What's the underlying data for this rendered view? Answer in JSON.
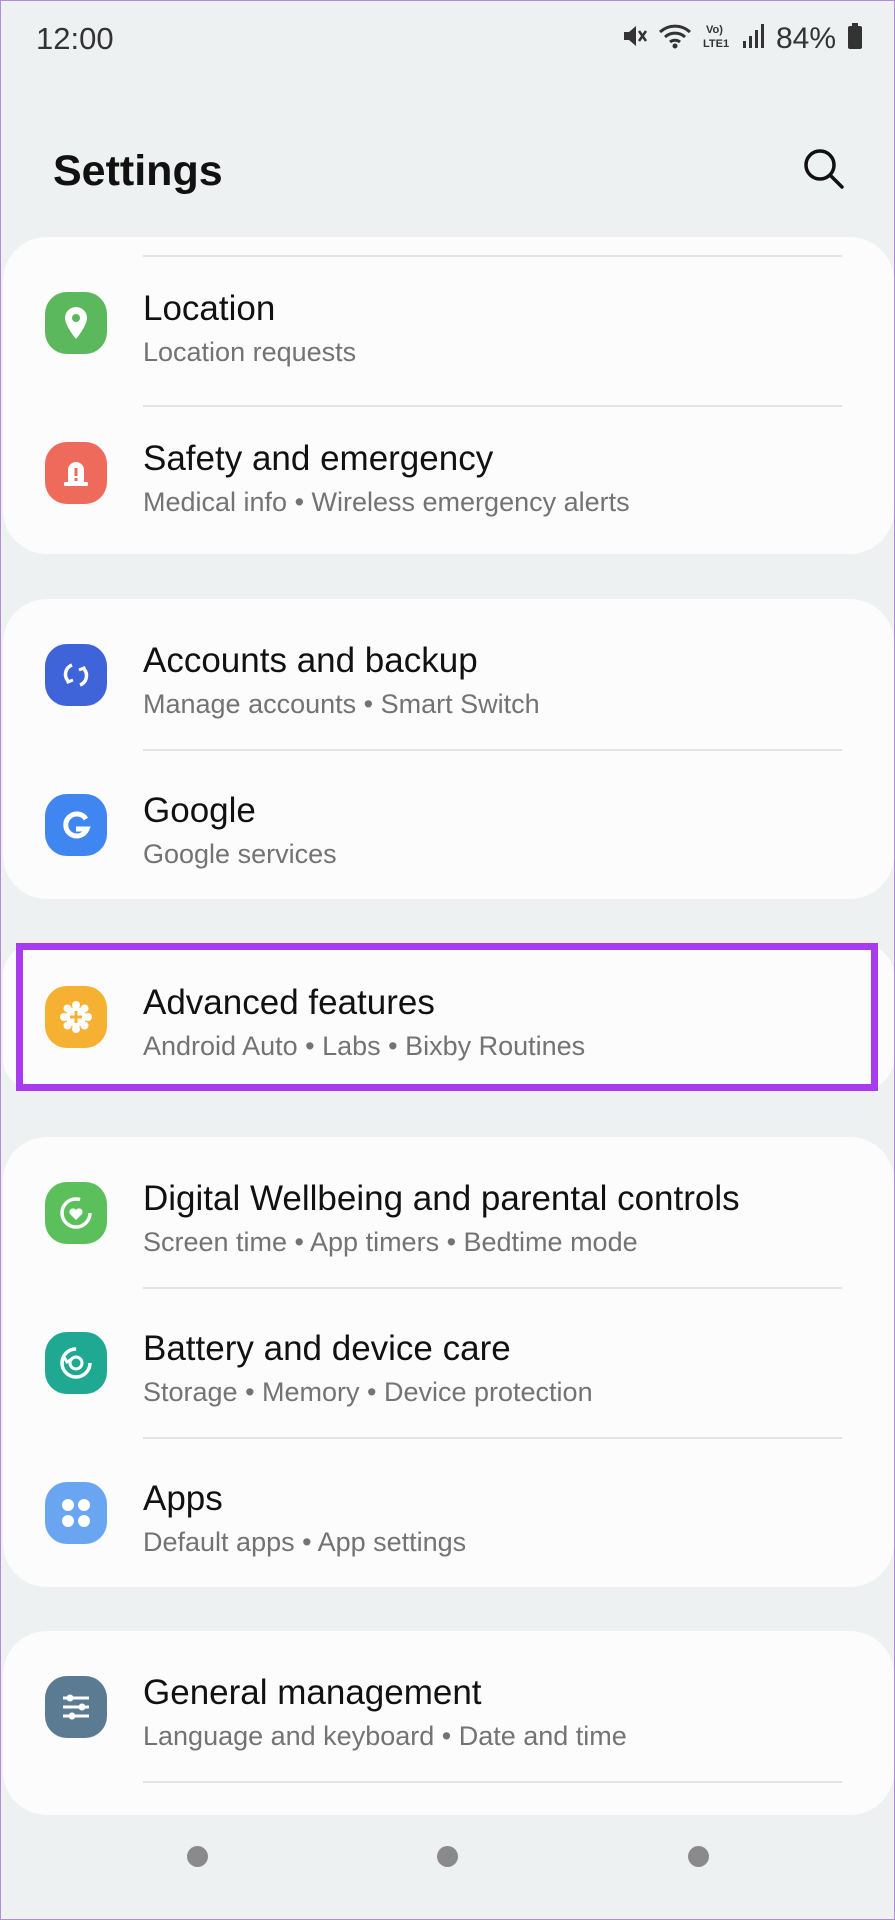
{
  "status_bar": {
    "time": "12:00",
    "battery": "84%"
  },
  "header": {
    "title": "Settings"
  },
  "items": [
    {
      "label": "Location",
      "sub": "Location requests",
      "icon": "location-pin-icon",
      "color": "#5cb85c"
    },
    {
      "label": "Safety and emergency",
      "sub": "Medical info  •  Wireless emergency alerts",
      "icon": "emergency-alert-icon",
      "color": "#ee6a5b"
    },
    {
      "label": "Accounts and backup",
      "sub": "Manage accounts  •  Smart Switch",
      "icon": "sync-icon",
      "color": "#3f63d8"
    },
    {
      "label": "Google",
      "sub": "Google services",
      "icon": "google-g-icon",
      "color": "#3f86f1"
    },
    {
      "label": "Advanced features",
      "sub": "Android Auto  •  Labs  •  Bixby Routines",
      "icon": "advanced-gear-plus-icon",
      "color": "#f6b133"
    },
    {
      "label": "Digital Wellbeing and parental controls",
      "sub": "Screen time  •  App timers  •  Bedtime mode",
      "icon": "wellbeing-heart-icon",
      "color": "#5bbf5b"
    },
    {
      "label": "Battery and device care",
      "sub": "Storage  •  Memory  •  Device protection",
      "icon": "device-care-icon",
      "color": "#1fa892"
    },
    {
      "label": "Apps",
      "sub": "Default apps  •  App settings",
      "icon": "apps-grid-icon",
      "color": "#6aa5f2"
    },
    {
      "label": "General management",
      "sub": "Language and keyboard  •  Date and time",
      "icon": "sliders-icon",
      "color": "#5a7b92"
    }
  ],
  "accent": "#a93bef"
}
